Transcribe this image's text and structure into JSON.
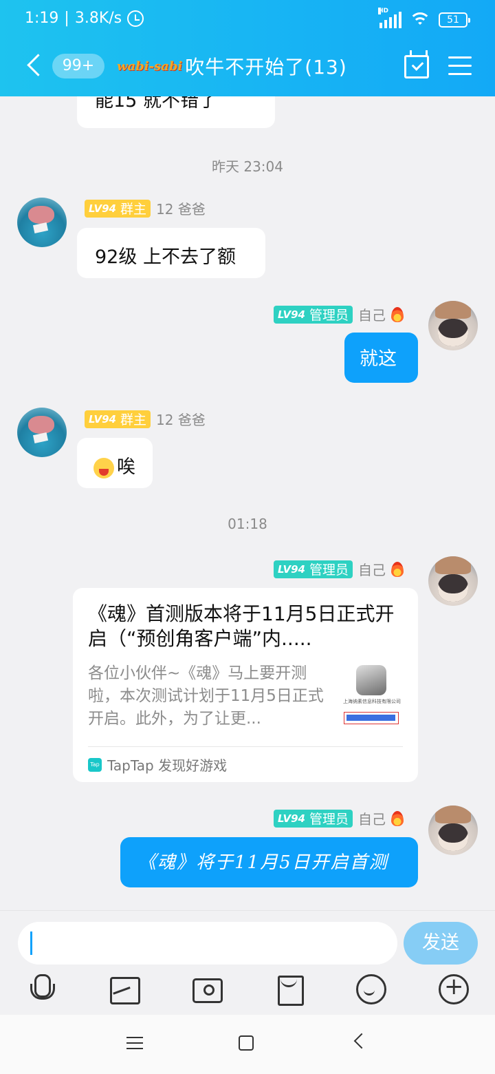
{
  "status_bar": {
    "time": "1:19",
    "speed": "3.8K/s",
    "battery": "51",
    "signal_label": "HD"
  },
  "header": {
    "unread_count": "99+",
    "group_prefix": "wabi-sabi",
    "group_name": "吹牛不开始了(13)"
  },
  "messages": {
    "partial_top": "能15 就不错了",
    "time1": "昨天 23:04",
    "m1": {
      "level": "LV94",
      "role": "群主",
      "name": "12 爸爸",
      "text": "92级 上不去了额"
    },
    "m2": {
      "level": "LV94",
      "role": "管理员",
      "name": "自己",
      "text": "就这"
    },
    "m3": {
      "level": "LV94",
      "role": "群主",
      "name": "12 爸爸",
      "text": "唉"
    },
    "time2": "01:18",
    "m4": {
      "level": "LV94",
      "role": "管理员",
      "name": "自己",
      "card_title": "《魂》首测版本将于11月5日正式开启（“预创角客户端”内.....",
      "card_desc": "各位小伙伴~《魂》马上要开测啦，本次测试计划于11月5日正式开启。此外，为了让更...",
      "thumb_text": "上海纳素信息科技有限公司",
      "source_logo": "Tap",
      "source": "TapTap 发现好游戏"
    },
    "m5": {
      "level": "LV94",
      "role": "管理员",
      "name": "自己",
      "text": "《魂》将于11月5日开启首测"
    }
  },
  "composer": {
    "input_value": "",
    "send_label": "发送"
  },
  "icons": [
    "back-icon",
    "calendar-icon",
    "menu-icon",
    "mic-icon",
    "image-icon",
    "camera-icon",
    "red-packet-icon",
    "emoji-icon",
    "plus-icon"
  ],
  "colors": {
    "header": "#17b3f4",
    "bubble_self": "#0ea1fb",
    "owner_badge": "#ffcf3c",
    "admin_badge": "#2ed1c2"
  }
}
